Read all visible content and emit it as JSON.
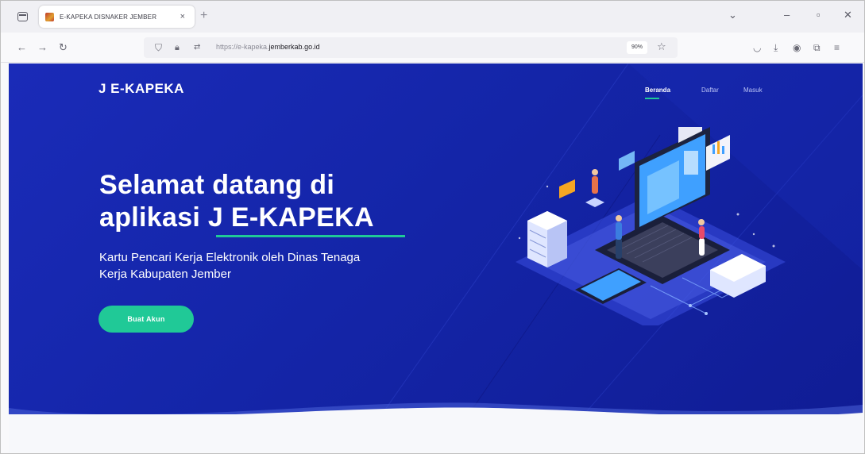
{
  "browser": {
    "tab_title": "E-KAPEKA DISNAKER JEMBER",
    "tab_close": "×",
    "new_tab": "+",
    "url_prefix": "https://e-kapeka.",
    "url_domain": "jemberkab.go.id",
    "zoom": "90%"
  },
  "site": {
    "brand": "J E-KAPEKA",
    "nav": [
      {
        "label": "Beranda",
        "active": true
      },
      {
        "label": "Daftar",
        "active": false
      },
      {
        "label": "Masuk",
        "active": false
      }
    ]
  },
  "hero": {
    "heading_line1": "Selamat datang di",
    "heading_line2_prefix": "aplikasi ",
    "heading_line2_highlight": "J E-KAPEKA",
    "subtitle_line1": "Kartu Pencari Kerja Elektronik oleh Dinas Tenaga",
    "subtitle_line2": "Kerja Kabupaten Jember",
    "cta_label": "Buat Akun"
  },
  "icons": {
    "tab_overview": "tab-overview-icon",
    "back": "back-arrow-icon",
    "forward": "forward-arrow-icon",
    "reload": "reload-icon",
    "shield": "tracking-protection-icon",
    "lock": "lock-icon",
    "permissions": "site-permissions-icon",
    "bookmark": "star-icon",
    "pocket": "pocket-icon",
    "download": "download-icon",
    "account": "account-icon",
    "extensions": "extensions-icon",
    "menu": "hamburger-menu-icon"
  },
  "colors": {
    "hero_blue": "#1425a8",
    "accent_green": "#20c997",
    "white": "#ffffff"
  }
}
